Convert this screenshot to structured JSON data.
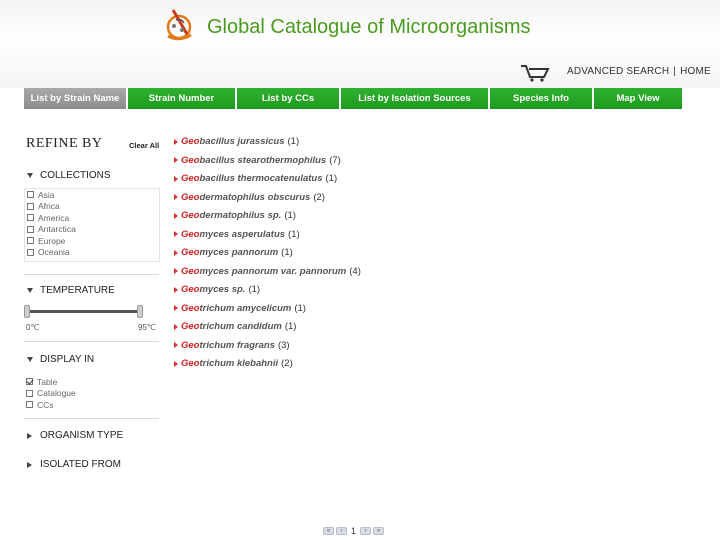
{
  "header": {
    "site_title": "Global Catalogue of Microorganisms",
    "logo": "gcm-logo-icon",
    "cart_icon": "cart-icon",
    "links": [
      "ADVANCED SEARCH",
      "HOME"
    ],
    "separator": "|"
  },
  "nav": {
    "tabs": [
      {
        "label": "List by Strain Name",
        "active": true
      },
      {
        "label": "Strain Number",
        "active": false
      },
      {
        "label": "List by CCs",
        "active": false
      },
      {
        "label": "List by Isolation Sources",
        "active": false
      },
      {
        "label": "Species Info",
        "active": false
      },
      {
        "label": "Map View",
        "active": false
      }
    ],
    "colors": {
      "active": "#999999",
      "inactive": "#22a322"
    }
  },
  "sidebar": {
    "refine_title": "REFINE BY",
    "clear_all": "Clear All",
    "collections": {
      "title": "COLLECTIONS",
      "items": [
        {
          "label": "Asia",
          "checked": false
        },
        {
          "label": "Africa",
          "checked": false
        },
        {
          "label": "America",
          "checked": false
        },
        {
          "label": "Antarctica",
          "checked": false
        },
        {
          "label": "Europe",
          "checked": false
        },
        {
          "label": "Oceania",
          "checked": false
        }
      ]
    },
    "temperature": {
      "title": "TEMPERATURE",
      "min_label": "0℃",
      "max_label": "95℃"
    },
    "display_in": {
      "title": "DISPLAY IN",
      "items": [
        {
          "label": "Table",
          "checked": true
        },
        {
          "label": "Catalogue",
          "checked": false
        },
        {
          "label": "CCs",
          "checked": false
        }
      ]
    },
    "organism_type": {
      "title": "ORGANISM TYPE"
    },
    "isolated_from": {
      "title": "ISOLATED FROM"
    }
  },
  "results": {
    "highlight_color": "#d02020",
    "items": [
      {
        "prefix": "Geo",
        "rest": "bacillus jurassicus",
        "count": "(1)"
      },
      {
        "prefix": "Geo",
        "rest": "bacillus stearothermophilus",
        "count": "(7)"
      },
      {
        "prefix": "Geo",
        "rest": "bacillus thermocatenulatus",
        "count": "(1)"
      },
      {
        "prefix": "Geo",
        "rest": "dermatophilus obscurus",
        "count": "(2)"
      },
      {
        "prefix": "Geo",
        "rest": "dermatophilus sp.",
        "count": "(1)"
      },
      {
        "prefix": "Geo",
        "rest": "myces asperulatus",
        "count": "(1)"
      },
      {
        "prefix": "Geo",
        "rest": "myces pannorum",
        "count": "(1)"
      },
      {
        "prefix": "Geo",
        "rest": "myces pannorum var. pannorum",
        "count": "(4)"
      },
      {
        "prefix": "Geo",
        "rest": "myces sp.",
        "count": "(1)"
      },
      {
        "prefix": "Geo",
        "rest": "trichum amycelicum",
        "count": "(1)"
      },
      {
        "prefix": "Geo",
        "rest": "trichum candidum",
        "count": "(1)"
      },
      {
        "prefix": "Geo",
        "rest": "trichum fragrans",
        "count": "(3)"
      },
      {
        "prefix": "Geo",
        "rest": "trichum klebahnii",
        "count": "(2)"
      }
    ]
  },
  "pager": {
    "first": "«",
    "prev": "‹",
    "current": "1",
    "next": "›",
    "last": "»"
  }
}
